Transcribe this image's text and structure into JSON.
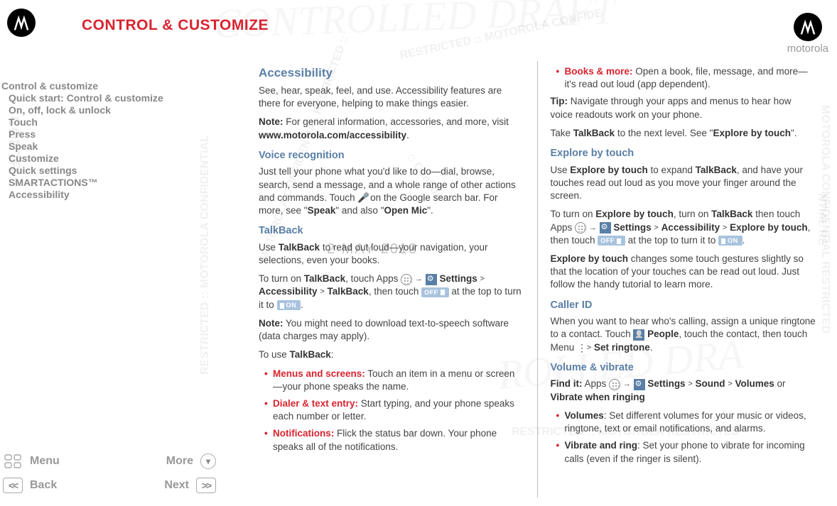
{
  "brand": "motorola",
  "page_title": "CONTROL & CUSTOMIZE",
  "watermark_date": "2 MAY 2013",
  "sidebar": {
    "items": [
      "Control & customize",
      "Quick start: Control & customize",
      "On, off, lock & unlock",
      "Touch",
      "Press",
      "Speak",
      "Customize",
      "Quick settings",
      "SMARTACTIONS™",
      "Accessibility"
    ]
  },
  "nav": {
    "menu": "Menu",
    "more": "More",
    "back": "Back",
    "next": "Next"
  },
  "col1": {
    "h_accessibility": "Accessibility",
    "p_intro": "See, hear, speak, feel, and use. Accessibility features are there for everyone, helping to make things easier.",
    "note_label": "Note:",
    "note_body": " For general information, accessories, and more, visit ",
    "note_link": "www.motorola.com/accessibility",
    "h_voice": "Voice recognition",
    "p_voice1": "Just tell your phone what you'd like to do—dial, browse, search, send a message, and a whole range of other actions and commands. Touch ",
    "p_voice2": " on the Google search bar. For more, see \"",
    "speak": "Speak",
    "p_voice3": "\" and also \"",
    "openmic": "Open Mic",
    "p_voice4": "\".",
    "h_talkback": "TalkBack",
    "p_tb1a": "Use ",
    "talkback": "TalkBack",
    "p_tb1b": " to read out loud—your navigation, your selections, even your books.",
    "p_tb2a": "To turn on ",
    "p_tb2b": ", touch Apps ",
    "p_tb2c": " ",
    "settings": "Settings",
    "arrow": " > ",
    "access": "Accessibility",
    "p_tb2d": ", then touch ",
    "off": "OFF",
    "p_tb2e": " at the top to turn it to ",
    "on": "ON",
    "note2_label": "Note:",
    "note2_body": " You might need to download text-to-speech software (data charges may apply).",
    "p_use": "To use ",
    "bullets": [
      {
        "title": "Menus and screens:",
        "body": " Touch an item in a menu or screen—your phone speaks the name."
      },
      {
        "title": "Dialer & text entry:",
        "body": " Start typing, and your phone speaks each number or letter."
      },
      {
        "title": "Notifications:",
        "body": " Flick the status bar down. Your phone speaks all of the notifications."
      }
    ]
  },
  "col2": {
    "bullet_books": {
      "title": "Books & more:",
      "body": " Open a book, file, message, and more—it's read out loud (app dependent)."
    },
    "tip_label": "Tip:",
    "tip_body": " Navigate through your apps and menus to hear how voice readouts work on your phone.",
    "p_take1": "Take ",
    "talkback": "TalkBack",
    "p_take2": " to the next level. See \"",
    "explore": "Explore by touch",
    "p_take3": "\".",
    "h_explore": "Explore by touch",
    "p_ex1a": "Use ",
    "p_ex1b": " to expand ",
    "p_ex1c": ", and have your touches read out loud as you move your finger around the screen.",
    "p_ex2a": "To turn on ",
    "p_ex2b": ", turn on ",
    "p_ex2c": " then touch Apps ",
    "settings": "Settings",
    "access": "Accessibility",
    "p_ex2d": ", then touch ",
    "off": "OFF",
    "p_ex2e": " at the top to turn it to ",
    "on": "ON",
    "p_ex3a": "",
    "p_ex3b": " changes some touch gestures slightly so that the location of your touches can be read out loud. Just follow the handy tutorial to learn more.",
    "h_caller": "Caller ID",
    "p_caller1": "When you want to hear who's calling, assign a unique ringtone to a contact. Touch ",
    "people": "People",
    "p_caller2": ", touch the contact, then touch Menu ",
    "setringtone": "Set ringtone",
    "h_volume": "Volume & vibrate",
    "findit_label": "Find it:",
    "findit_body1": " Apps ",
    "sound": "Sound",
    "volumes": "Volumes",
    "or": " or ",
    "vibratewhen": "Vibrate when ringing",
    "bullets": [
      {
        "title": "Volumes",
        "body": ": Set different volumes for your music or videos, ringtone, text or email notifications, and alarms."
      },
      {
        "title": "Vibrate and ring",
        "body": ": Set your phone to vibrate for incoming calls (even if the ringer is silent)."
      }
    ]
  }
}
